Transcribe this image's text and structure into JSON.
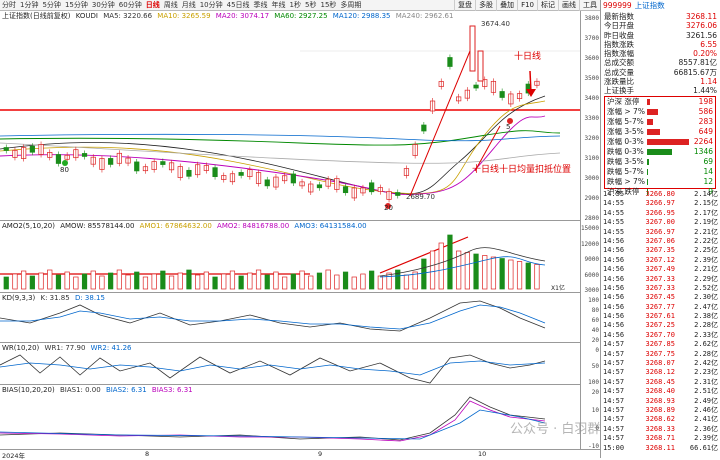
{
  "toolbar": {
    "periods": [
      "分时",
      "1分钟",
      "5分钟",
      "15分钟",
      "30分钟",
      "60分钟",
      "日线",
      "周线",
      "月线",
      "10分钟",
      "45日线",
      "季线",
      "年线",
      "1秒",
      "5秒",
      "15秒",
      "多周期"
    ],
    "active_period": "日线",
    "buttons": [
      "复盘",
      "多股",
      "叠加",
      "F10",
      "标记",
      "画线",
      "工具"
    ]
  },
  "main_legend": {
    "title": "上证指数(日线前复权)",
    "indicator": "KOUDI",
    "ma5": "MA5: 3220.66",
    "ma10": "MA10: 3265.59",
    "ma20": "MA20: 3074.17",
    "ma60": "MA60: 2927.25",
    "ma120": "MA120: 2988.35",
    "ma240": "MA240: 2962.61"
  },
  "main_axis": [
    "3800",
    "3700",
    "3600",
    "3500",
    "3400",
    "3300",
    "3200",
    "3100",
    "3000",
    "2900",
    "2800"
  ],
  "price_labels": {
    "high": "3674.40",
    "low": "2689.70",
    "mark_80": "80",
    "mark_20": "20",
    "mark_5": "5"
  },
  "annotations": {
    "ten_day": "十日线",
    "ten_day_volume": "十日线十日均量扣抵位置"
  },
  "volume_legend": {
    "name": "AMO2(5,10,20)",
    "amow": "AMOW: 85578144.00",
    "amo1": "AMO1: 67864632.00",
    "amo2": "AMO2: 84816788.00",
    "amo3": "AMO3: 64131584.00"
  },
  "volume_axis": [
    "15000",
    "12000",
    "9000",
    "6000",
    "3000"
  ],
  "volume_unit": "X1亿",
  "kd_legend": {
    "name": "KD(9,3,3)",
    "k": "K: 31.85",
    "d": "D: 38.15"
  },
  "kd_axis": [
    "100",
    "80",
    "60",
    "40",
    "20"
  ],
  "wr_legend": {
    "name": "WR(10,20)",
    "wr1": "WR1: 77.90",
    "wr2": "WR2: 41.26"
  },
  "wr_axis": [
    "0",
    "50",
    "100"
  ],
  "bias_legend": {
    "name": "BIAS(10,20,20)",
    "b1": "BIAS1: 0.00",
    "b2": "BIAS2: 6.31",
    "b3": "BIAS3: 6.31"
  },
  "bias_axis": [
    "20",
    "10",
    "0",
    "-10"
  ],
  "date_axis": {
    "year": "2024年",
    "m8": "8",
    "m9": "9",
    "m10": "10"
  },
  "right_panel": {
    "code": "999999",
    "name": "上证指数",
    "rows": [
      {
        "label": "最新指数",
        "value": "3268.11",
        "color": "red"
      },
      {
        "label": "今日开盘",
        "value": "3276.06",
        "color": "red"
      },
      {
        "label": "昨日收盘",
        "value": "3261.56",
        "color": "black"
      },
      {
        "label": "指数涨跌",
        "value": "6.55",
        "color": "red"
      },
      {
        "label": "指数涨幅",
        "value": "0.20%",
        "color": "red"
      },
      {
        "label": "总成交额",
        "value": "8557.81亿",
        "color": "black"
      },
      {
        "label": "总成交量",
        "value": "66815.67万",
        "color": "black"
      },
      {
        "label": "涨跌量比",
        "value": "1.14",
        "color": "red"
      },
      {
        "label": "上证换手",
        "value": "1.44%",
        "color": "black"
      }
    ],
    "distribution": [
      {
        "label": "沪深 涨停",
        "count": "198",
        "bar": 0.08,
        "color": "red"
      },
      {
        "label": "涨幅 > 7%",
        "count": "586",
        "bar": 0.26,
        "color": "red"
      },
      {
        "label": "涨幅 5-7%",
        "count": "283",
        "bar": 0.14,
        "color": "red"
      },
      {
        "label": "涨幅 3-5%",
        "count": "649",
        "bar": 0.3,
        "color": "red"
      },
      {
        "label": "涨幅 0-3%",
        "count": "2264",
        "bar": 1.0,
        "color": "red"
      },
      {
        "label": "跌幅 0-3%",
        "count": "1346",
        "bar": 0.6,
        "color": "green"
      },
      {
        "label": "跌幅 3-5%",
        "count": "69",
        "bar": 0.04,
        "color": "green"
      },
      {
        "label": "跌幅 5-7%",
        "count": "14",
        "bar": 0.02,
        "color": "green"
      },
      {
        "label": "跌幅 > 7%",
        "count": "12",
        "bar": 0.02,
        "color": "green"
      },
      {
        "label": "沪深 跌停",
        "count": "9",
        "bar": 0.01,
        "color": "green"
      }
    ],
    "ticks": [
      {
        "t": "14:55",
        "p": "3266.80",
        "v": "2.14亿"
      },
      {
        "t": "14:55",
        "p": "3266.97",
        "v": "2.15亿"
      },
      {
        "t": "14:55",
        "p": "3266.95",
        "v": "2.17亿"
      },
      {
        "t": "14:55",
        "p": "3267.00",
        "v": "2.19亿"
      },
      {
        "t": "14:55",
        "p": "3266.97",
        "v": "2.21亿"
      },
      {
        "t": "14:56",
        "p": "3267.06",
        "v": "2.22亿"
      },
      {
        "t": "14:56",
        "p": "3267.35",
        "v": "2.25亿"
      },
      {
        "t": "14:56",
        "p": "3267.12",
        "v": "2.39亿"
      },
      {
        "t": "14:56",
        "p": "3267.49",
        "v": "2.21亿"
      },
      {
        "t": "14:56",
        "p": "3267.33",
        "v": "2.29亿"
      },
      {
        "t": "14:56",
        "p": "3267.33",
        "v": "2.52亿"
      },
      {
        "t": "14:56",
        "p": "3267.45",
        "v": "2.30亿"
      },
      {
        "t": "14:56",
        "p": "3267.77",
        "v": "2.47亿"
      },
      {
        "t": "14:56",
        "p": "3267.61",
        "v": "2.38亿"
      },
      {
        "t": "14:56",
        "p": "3267.25",
        "v": "2.28亿"
      },
      {
        "t": "14:56",
        "p": "3267.70",
        "v": "2.33亿"
      },
      {
        "t": "14:57",
        "p": "3267.85",
        "v": "2.62亿"
      },
      {
        "t": "14:57",
        "p": "3267.75",
        "v": "2.28亿"
      },
      {
        "t": "14:57",
        "p": "3268.07",
        "v": "2.42亿"
      },
      {
        "t": "14:57",
        "p": "3268.12",
        "v": "2.23亿"
      },
      {
        "t": "14:57",
        "p": "3268.45",
        "v": "2.31亿"
      },
      {
        "t": "14:57",
        "p": "3268.40",
        "v": "2.51亿"
      },
      {
        "t": "14:57",
        "p": "3268.93",
        "v": "2.49亿"
      },
      {
        "t": "14:57",
        "p": "3268.89",
        "v": "2.46亿"
      },
      {
        "t": "14:57",
        "p": "3268.62",
        "v": "2.41亿"
      },
      {
        "t": "14:57",
        "p": "3268.33",
        "v": "2.36亿"
      },
      {
        "t": "14:57",
        "p": "3268.71",
        "v": "2.39亿"
      },
      {
        "t": "15:00",
        "p": "3268.11",
        "v": "66.61亿"
      }
    ]
  },
  "watermark": "公众号 · 白羽群"
}
